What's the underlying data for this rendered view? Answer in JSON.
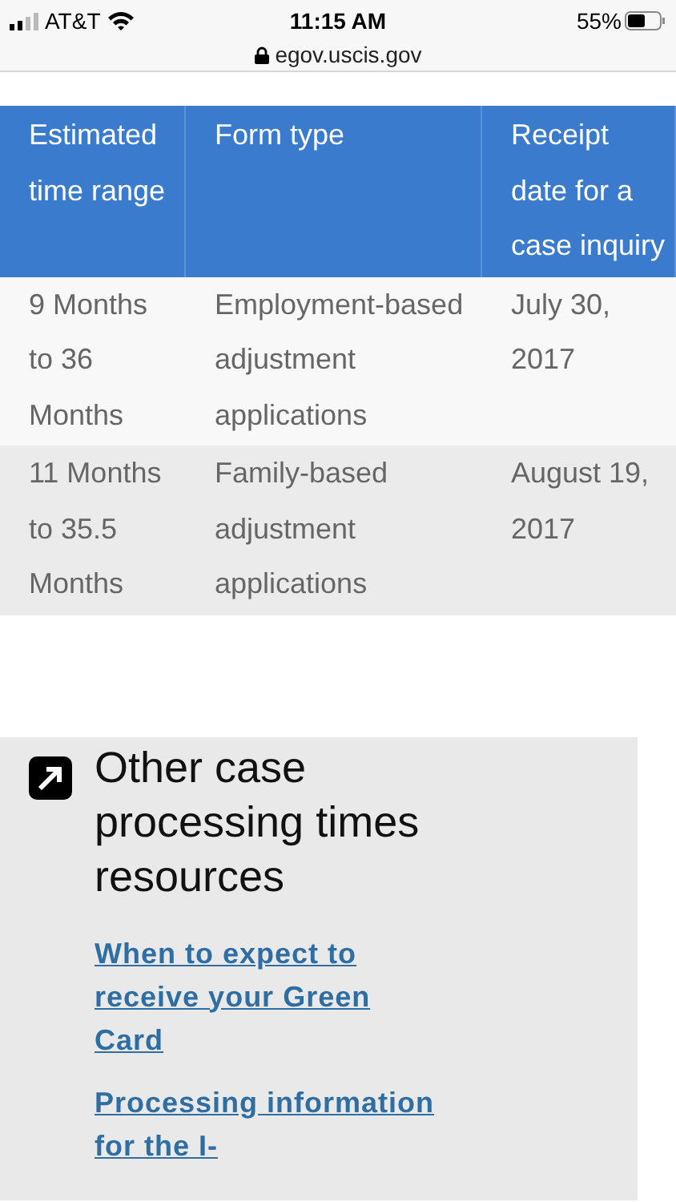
{
  "status_bar": {
    "carrier": "AT&T",
    "time": "11:15 AM",
    "battery": "55%",
    "url": "egov.uscis.gov"
  },
  "table": {
    "columns": [
      "Estimated time range",
      "Form type",
      "Receipt date for a case inquiry"
    ],
    "rows": [
      [
        "9 Months to 36 Months",
        "Employment-based adjustment applications",
        "July 30, 2017"
      ],
      [
        "11 Months to 35.5 Months",
        "Family-based adjustment applications",
        "August 19, 2017"
      ]
    ]
  },
  "resources": {
    "title": "Other case processing times resources",
    "links": [
      "When to expect to receive your Green Card",
      "Processing information for the I-"
    ]
  }
}
